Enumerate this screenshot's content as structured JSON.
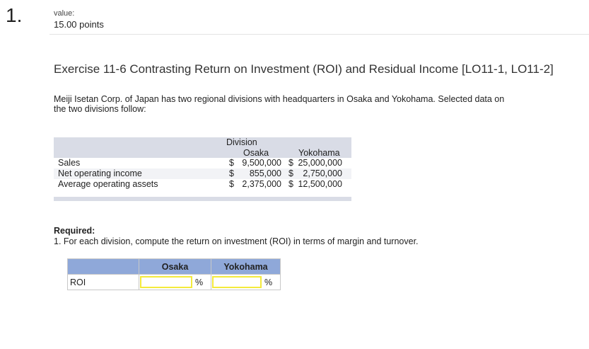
{
  "question": {
    "number": "1.",
    "value_label": "value:",
    "points": "15.00 points"
  },
  "title": "Exercise 11-6 Contrasting Return on Investment (ROI) and Residual Income [LO11-1, LO11-2]",
  "intro": "Meiji Isetan Corp. of Japan has two regional divisions with headquarters in Osaka and Yokohama. Selected data on the two divisions follow:",
  "data_table": {
    "group_header": "Division",
    "columns": [
      "Osaka",
      "Yokohama"
    ],
    "rows": [
      {
        "label": "Sales",
        "osaka": "9,500,000",
        "yokohama": "25,000,000"
      },
      {
        "label": "Net operating income",
        "osaka": "855,000",
        "yokohama": "2,750,000"
      },
      {
        "label": "Average operating assets",
        "osaka": "2,375,000",
        "yokohama": "12,500,000"
      }
    ],
    "currency": "$"
  },
  "required": {
    "heading": "Required:",
    "item1": "1. For each division, compute the return on investment (ROI) in terms of margin and turnover."
  },
  "answer_table": {
    "columns": [
      "Osaka",
      "Yokohama"
    ],
    "row_label": "ROI",
    "unit": "%",
    "osaka_value": "",
    "yokohama_value": ""
  }
}
